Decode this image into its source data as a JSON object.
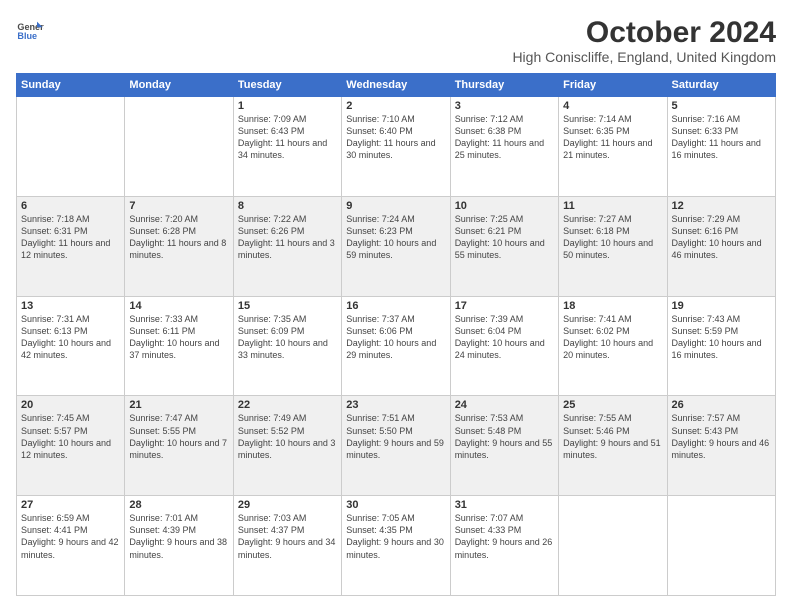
{
  "logo": {
    "line1": "General",
    "line2": "Blue"
  },
  "title": "October 2024",
  "location": "High Coniscliffe, England, United Kingdom",
  "days_of_week": [
    "Sunday",
    "Monday",
    "Tuesday",
    "Wednesday",
    "Thursday",
    "Friday",
    "Saturday"
  ],
  "weeks": [
    [
      {
        "day": "",
        "info": ""
      },
      {
        "day": "",
        "info": ""
      },
      {
        "day": "1",
        "info": "Sunrise: 7:09 AM\nSunset: 6:43 PM\nDaylight: 11 hours and 34 minutes."
      },
      {
        "day": "2",
        "info": "Sunrise: 7:10 AM\nSunset: 6:40 PM\nDaylight: 11 hours and 30 minutes."
      },
      {
        "day": "3",
        "info": "Sunrise: 7:12 AM\nSunset: 6:38 PM\nDaylight: 11 hours and 25 minutes."
      },
      {
        "day": "4",
        "info": "Sunrise: 7:14 AM\nSunset: 6:35 PM\nDaylight: 11 hours and 21 minutes."
      },
      {
        "day": "5",
        "info": "Sunrise: 7:16 AM\nSunset: 6:33 PM\nDaylight: 11 hours and 16 minutes."
      }
    ],
    [
      {
        "day": "6",
        "info": "Sunrise: 7:18 AM\nSunset: 6:31 PM\nDaylight: 11 hours and 12 minutes."
      },
      {
        "day": "7",
        "info": "Sunrise: 7:20 AM\nSunset: 6:28 PM\nDaylight: 11 hours and 8 minutes."
      },
      {
        "day": "8",
        "info": "Sunrise: 7:22 AM\nSunset: 6:26 PM\nDaylight: 11 hours and 3 minutes."
      },
      {
        "day": "9",
        "info": "Sunrise: 7:24 AM\nSunset: 6:23 PM\nDaylight: 10 hours and 59 minutes."
      },
      {
        "day": "10",
        "info": "Sunrise: 7:25 AM\nSunset: 6:21 PM\nDaylight: 10 hours and 55 minutes."
      },
      {
        "day": "11",
        "info": "Sunrise: 7:27 AM\nSunset: 6:18 PM\nDaylight: 10 hours and 50 minutes."
      },
      {
        "day": "12",
        "info": "Sunrise: 7:29 AM\nSunset: 6:16 PM\nDaylight: 10 hours and 46 minutes."
      }
    ],
    [
      {
        "day": "13",
        "info": "Sunrise: 7:31 AM\nSunset: 6:13 PM\nDaylight: 10 hours and 42 minutes."
      },
      {
        "day": "14",
        "info": "Sunrise: 7:33 AM\nSunset: 6:11 PM\nDaylight: 10 hours and 37 minutes."
      },
      {
        "day": "15",
        "info": "Sunrise: 7:35 AM\nSunset: 6:09 PM\nDaylight: 10 hours and 33 minutes."
      },
      {
        "day": "16",
        "info": "Sunrise: 7:37 AM\nSunset: 6:06 PM\nDaylight: 10 hours and 29 minutes."
      },
      {
        "day": "17",
        "info": "Sunrise: 7:39 AM\nSunset: 6:04 PM\nDaylight: 10 hours and 24 minutes."
      },
      {
        "day": "18",
        "info": "Sunrise: 7:41 AM\nSunset: 6:02 PM\nDaylight: 10 hours and 20 minutes."
      },
      {
        "day": "19",
        "info": "Sunrise: 7:43 AM\nSunset: 5:59 PM\nDaylight: 10 hours and 16 minutes."
      }
    ],
    [
      {
        "day": "20",
        "info": "Sunrise: 7:45 AM\nSunset: 5:57 PM\nDaylight: 10 hours and 12 minutes."
      },
      {
        "day": "21",
        "info": "Sunrise: 7:47 AM\nSunset: 5:55 PM\nDaylight: 10 hours and 7 minutes."
      },
      {
        "day": "22",
        "info": "Sunrise: 7:49 AM\nSunset: 5:52 PM\nDaylight: 10 hours and 3 minutes."
      },
      {
        "day": "23",
        "info": "Sunrise: 7:51 AM\nSunset: 5:50 PM\nDaylight: 9 hours and 59 minutes."
      },
      {
        "day": "24",
        "info": "Sunrise: 7:53 AM\nSunset: 5:48 PM\nDaylight: 9 hours and 55 minutes."
      },
      {
        "day": "25",
        "info": "Sunrise: 7:55 AM\nSunset: 5:46 PM\nDaylight: 9 hours and 51 minutes."
      },
      {
        "day": "26",
        "info": "Sunrise: 7:57 AM\nSunset: 5:43 PM\nDaylight: 9 hours and 46 minutes."
      }
    ],
    [
      {
        "day": "27",
        "info": "Sunrise: 6:59 AM\nSunset: 4:41 PM\nDaylight: 9 hours and 42 minutes."
      },
      {
        "day": "28",
        "info": "Sunrise: 7:01 AM\nSunset: 4:39 PM\nDaylight: 9 hours and 38 minutes."
      },
      {
        "day": "29",
        "info": "Sunrise: 7:03 AM\nSunset: 4:37 PM\nDaylight: 9 hours and 34 minutes."
      },
      {
        "day": "30",
        "info": "Sunrise: 7:05 AM\nSunset: 4:35 PM\nDaylight: 9 hours and 30 minutes."
      },
      {
        "day": "31",
        "info": "Sunrise: 7:07 AM\nSunset: 4:33 PM\nDaylight: 9 hours and 26 minutes."
      },
      {
        "day": "",
        "info": ""
      },
      {
        "day": "",
        "info": ""
      }
    ]
  ]
}
